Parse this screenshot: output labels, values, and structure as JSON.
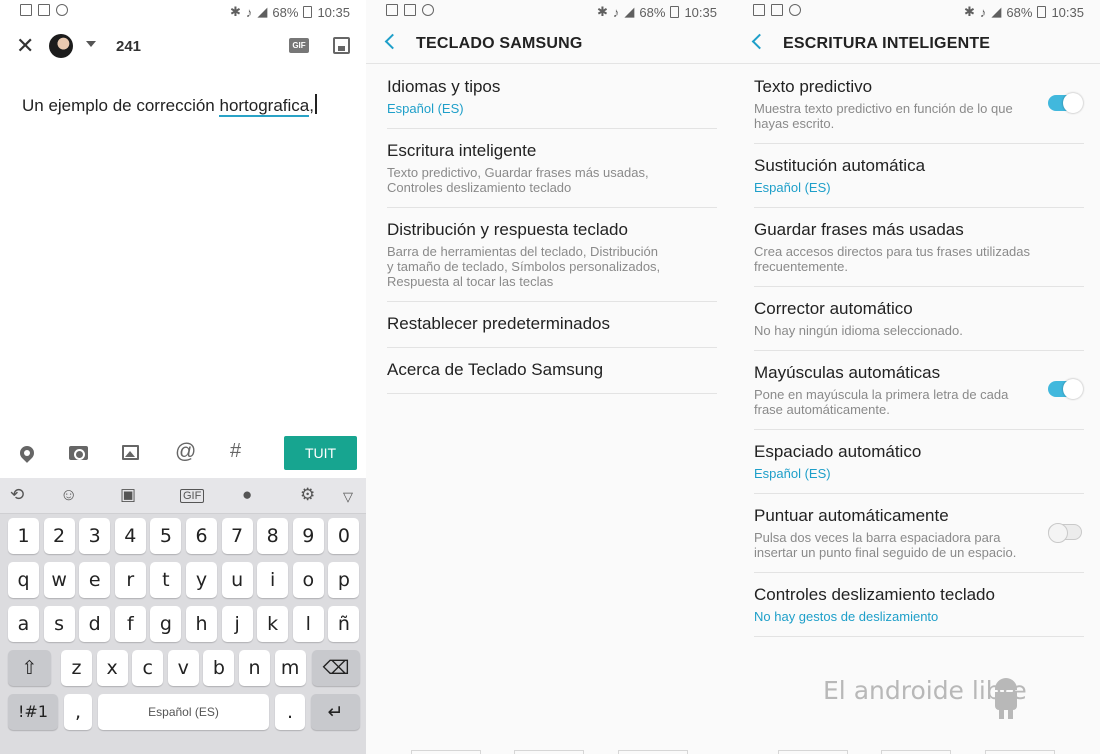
{
  "status_bar": {
    "battery": "68%",
    "time": "10:35"
  },
  "compose": {
    "char_count": "241",
    "gif_label": "GIF",
    "text_before": "Un ejemplo de corrección ",
    "misspelled_word": "hortografica",
    "text_after": ",",
    "tuit_label": "TUIT",
    "icons": [
      "close-icon",
      "avatar",
      "chevron-down-icon",
      "gif-icon",
      "save-draft-icon",
      "location-icon",
      "camera-icon",
      "image-icon",
      "at-icon",
      "hashtag-icon"
    ]
  },
  "keyboard": {
    "toolbar_icons": [
      "text-recognition-icon",
      "emoji-icon",
      "sticker-icon",
      "gif-icon",
      "mic-icon",
      "gear-icon",
      "chevron-down-icon"
    ],
    "row_numbers": [
      "1",
      "2",
      "3",
      "4",
      "5",
      "6",
      "7",
      "8",
      "9",
      "0"
    ],
    "row_1": [
      "q",
      "w",
      "e",
      "r",
      "t",
      "y",
      "u",
      "i",
      "o",
      "p"
    ],
    "row_2": [
      "a",
      "s",
      "d",
      "f",
      "g",
      "h",
      "j",
      "k",
      "l",
      "ñ"
    ],
    "row_3": [
      "z",
      "x",
      "c",
      "v",
      "b",
      "n",
      "m"
    ],
    "symbols_label": "!#1",
    "comma_label": ",",
    "space_label": "Español (ES)",
    "period_label": ".",
    "shift_glyph": "⇧",
    "delete_glyph": "⌫",
    "enter_glyph": "↵"
  },
  "samsung_keyboard": {
    "title": "TECLADO SAMSUNG",
    "items": [
      {
        "title": "Idiomas y tipos",
        "value": "Español (ES)"
      },
      {
        "title": "Escritura inteligente",
        "summary": [
          "Texto predictivo, Guardar frases más usadas,",
          "Controles deslizamiento teclado"
        ]
      },
      {
        "title": "Distribución y respuesta teclado",
        "summary": [
          "Barra de herramientas del teclado, Distribución",
          "y tamaño de teclado, Símbolos personalizados,",
          "Respuesta al tocar las teclas"
        ]
      },
      {
        "title": "Restablecer predeterminados"
      },
      {
        "title": "Acerca de Teclado Samsung"
      }
    ]
  },
  "smart_typing": {
    "title": "ESCRITURA INTELIGENTE",
    "items": [
      {
        "title": "Texto predictivo",
        "summary": [
          "Muestra texto predictivo en función de lo que",
          "hayas escrito."
        ],
        "toggle": "on"
      },
      {
        "title": "Sustitución automática",
        "value": "Español (ES)"
      },
      {
        "title": "Guardar frases más usadas",
        "summary": [
          "Crea accesos directos para tus frases utilizadas",
          "frecuentemente."
        ]
      },
      {
        "title": "Corrector automático",
        "summary": [
          "No hay ningún idioma seleccionado."
        ]
      },
      {
        "title": "Mayúsculas automáticas",
        "summary": [
          "Pone en mayúscula la primera letra de cada",
          "frase automáticamente."
        ],
        "toggle": "on"
      },
      {
        "title": "Espaciado automático",
        "value": "Español (ES)"
      },
      {
        "title": "Puntuar automáticamente",
        "summary": [
          "Pulsa dos veces la barra espaciadora para",
          "insertar un punto final seguido de un espacio."
        ],
        "toggle": "off"
      },
      {
        "title": "Controles deslizamiento teclado",
        "value": "No hay gestos de deslizamiento"
      }
    ]
  },
  "watermark": "El androide libre",
  "colors": {
    "accent": "#1e9fc9",
    "tuit_button": "#17a590",
    "toggle_on": "#41b8dd"
  }
}
